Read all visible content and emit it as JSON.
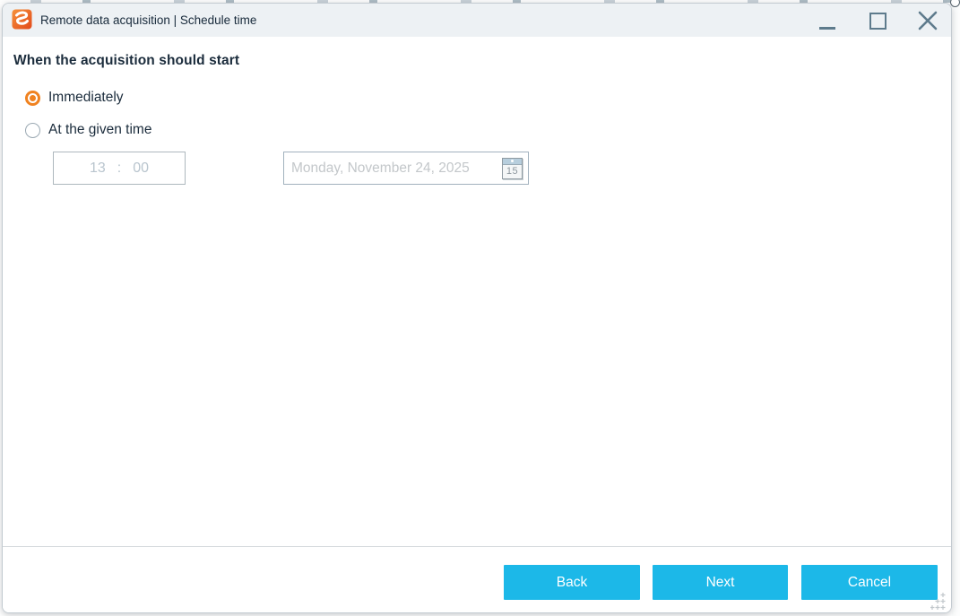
{
  "window": {
    "title": "Remote data acquisition | Schedule time",
    "controls": [
      {
        "name": "minimize"
      },
      {
        "name": "maximize"
      },
      {
        "name": "close"
      }
    ]
  },
  "content": {
    "heading": "When the acquisition should start",
    "options": [
      {
        "label": "Immediately",
        "selected": true
      },
      {
        "label": "At the given time",
        "selected": false
      }
    ],
    "time_input": {
      "hours": "13",
      "separator": ":",
      "minutes": "00",
      "enabled": false
    },
    "date_input": {
      "value": "Monday, November 24, 2025",
      "calendar_icon_day": "15",
      "enabled": false
    }
  },
  "footer": {
    "buttons": [
      {
        "label": "Back"
      },
      {
        "label": "Next"
      },
      {
        "label": "Cancel"
      }
    ]
  },
  "icons": [
    "app-logo-icon",
    "minimize-icon",
    "maximize-icon",
    "close-icon",
    "radio-selected-icon",
    "radio-unselected-icon",
    "calendar-icon",
    "resize-grip"
  ],
  "colors": {
    "titlebar": "#EDF1F4",
    "text_dark": "#1B2C3C",
    "control_glyph": "#5E7B8C",
    "accent_orange": "#F08220",
    "button_cyan": "#1CB8E8",
    "disabled_text": "#B9C5CE",
    "date_text": "#C3C7CA",
    "separator": "#D8DCDF"
  }
}
